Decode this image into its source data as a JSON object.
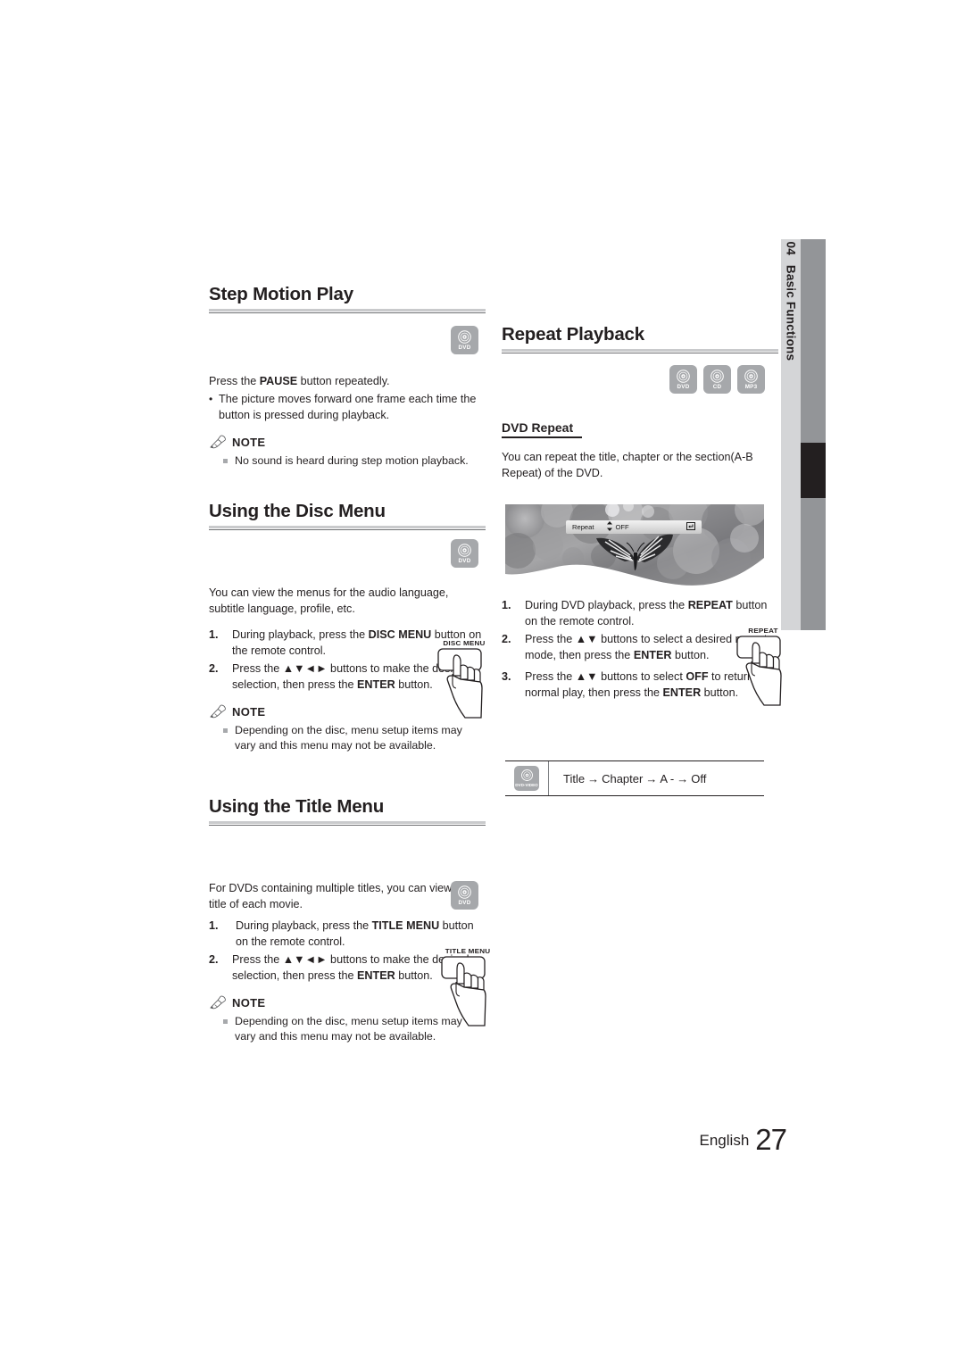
{
  "side_tab": {
    "number": "04",
    "label": "Basic Functions"
  },
  "footer": {
    "language": "English",
    "page_number": "27"
  },
  "left_column": {
    "sections": [
      {
        "heading": "Step Motion Play",
        "badges": [
          {
            "label": "DVD",
            "icon": "disc-icon"
          }
        ],
        "intro_lead": "Press the ",
        "intro_bold": "PAUSE",
        "intro_tail": " button repeatedly.",
        "bullet": "The picture moves forward one frame each time the button is pressed during playback.",
        "note_title": "NOTE",
        "note_items": [
          "No sound is heard during step motion playback."
        ]
      },
      {
        "heading": "Using the Disc Menu",
        "badges": [
          {
            "label": "DVD",
            "icon": "disc-icon"
          }
        ],
        "intro": "You can view the menus for the audio language, subtitle language, profile, etc.",
        "remote_label": "DISC MENU",
        "steps": [
          {
            "n": "1.",
            "parts": [
              {
                "t": "During playback, press the ",
                "b": false
              },
              {
                "t": "DISC MENU",
                "b": true
              },
              {
                "t": " button on the remote control.",
                "b": false
              }
            ]
          },
          {
            "n": "2.",
            "parts": [
              {
                "t": "Press the ",
                "b": false
              },
              {
                "t": "▲▼◄►",
                "b": true
              },
              {
                "t": " buttons to make the desired selection, then press the ",
                "b": false
              },
              {
                "t": "ENTER",
                "b": true
              },
              {
                "t": " button.",
                "b": false
              }
            ]
          }
        ],
        "note_title": "NOTE",
        "note_items": [
          "Depending on the disc, menu setup items may vary and this menu may not be available."
        ]
      },
      {
        "heading": "Using the Title Menu",
        "badges": [
          {
            "label": "DVD",
            "icon": "disc-icon"
          }
        ],
        "intro": "For DVDs containing multiple titles, you can view the title of each movie.",
        "remote_label": "TITLE MENU",
        "steps": [
          {
            "n": "1.",
            "parts": [
              {
                "t": "During playback, press the ",
                "b": false
              },
              {
                "t": "TITLE MENU",
                "b": true
              },
              {
                "t": " button on the remote control.",
                "b": false
              }
            ]
          },
          {
            "n": "2.",
            "parts": [
              {
                "t": "Press the ",
                "b": false
              },
              {
                "t": "▲▼◄►",
                "b": true
              },
              {
                "t": " buttons to make the desired selection, then press the ",
                "b": false
              },
              {
                "t": "ENTER",
                "b": true
              },
              {
                "t": " button.",
                "b": false
              }
            ]
          }
        ],
        "note_title": "NOTE",
        "note_items": [
          "Depending on the disc, menu setup items may vary and this menu may not be available."
        ]
      }
    ]
  },
  "right_column": {
    "heading": "Repeat Playback",
    "badges": [
      {
        "label": "DVD",
        "icon": "disc-icon"
      },
      {
        "label": "CD",
        "icon": "disc-icon"
      },
      {
        "label": "MP3",
        "icon": "disc-icon"
      }
    ],
    "subheading": "DVD Repeat",
    "intro": "You can repeat the title, chapter or the section(A-B Repeat) of the DVD.",
    "screenshot": {
      "caption_alt": "butterfly-on-flowers-photo",
      "osd_label": "Repeat",
      "osd_caret": "↕",
      "osd_value": "OFF",
      "osd_return_icon": "return-icon"
    },
    "remote_label": "REPEAT",
    "steps": [
      {
        "n": "1.",
        "parts": [
          {
            "t": "During DVD playback, press the ",
            "b": false
          },
          {
            "t": "REPEAT",
            "b": true
          },
          {
            "t": " button on the remote control.",
            "b": false
          }
        ]
      },
      {
        "n": "2.",
        "parts": [
          {
            "t": "Press the ",
            "b": false
          },
          {
            "t": "▲▼",
            "b": true
          },
          {
            "t": " buttons to select a desired repeat mode, then press the ",
            "b": false
          },
          {
            "t": "ENTER",
            "b": true
          },
          {
            "t": " button.",
            "b": false
          }
        ]
      },
      {
        "n": "3.",
        "parts": [
          {
            "t": "Press the ",
            "b": false
          },
          {
            "t": "▲▼",
            "b": true
          },
          {
            "t": " buttons to select ",
            "b": false
          },
          {
            "t": "OFF",
            "b": true
          },
          {
            "t": " to return to normal play, then press the ",
            "b": false
          },
          {
            "t": "ENTER",
            "b": true
          },
          {
            "t": " button.",
            "b": false
          }
        ]
      }
    ],
    "sequence": {
      "badge": {
        "label": "DVD-VIDEO",
        "icon": "disc-icon"
      },
      "items": [
        "Title",
        "Chapter",
        "A -",
        "Off"
      ],
      "arrow": "→"
    }
  },
  "colors": {
    "text": "#231f20",
    "rule_light": "#c9cacc",
    "badge_gray": "#a6a8ab",
    "tab_gray": "#939598",
    "tab_light": "#d4d5d7",
    "tab_marker": "#231f20"
  }
}
